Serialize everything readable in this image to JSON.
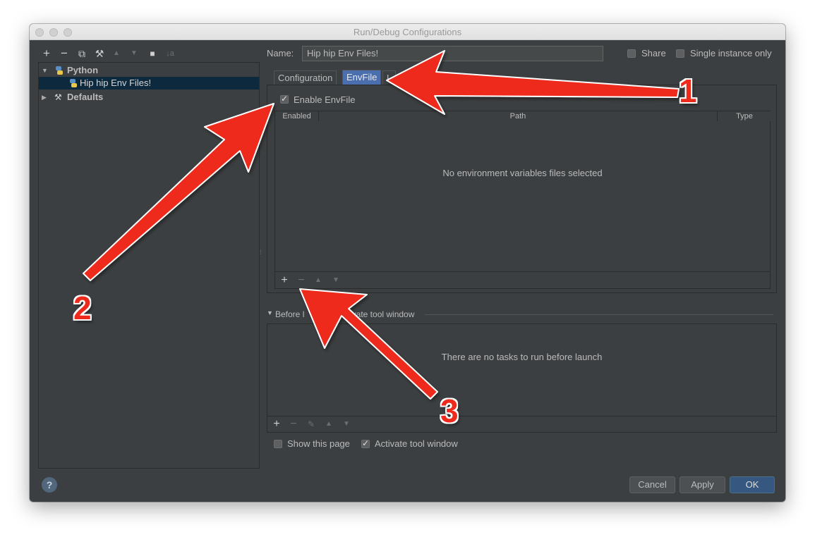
{
  "window": {
    "title": "Run/Debug Configurations"
  },
  "toolbar": {
    "buttons": [
      {
        "name": "add",
        "glyph": "+"
      },
      {
        "name": "remove",
        "glyph": "−"
      },
      {
        "name": "copy",
        "glyph": "⧉"
      },
      {
        "name": "edit-defaults",
        "glyph": "⚒"
      },
      {
        "name": "move-up",
        "glyph": "▲"
      },
      {
        "name": "move-down",
        "glyph": "▼"
      },
      {
        "name": "folder",
        "glyph": "■"
      },
      {
        "name": "sort",
        "glyph": "↓a"
      }
    ]
  },
  "tree": {
    "python": "Python",
    "config": "Hip hip Env Files!",
    "defaults": "Defaults"
  },
  "form": {
    "name_label": "Name:",
    "name_value": "Hip hip Env Files!",
    "share_label": "Share",
    "single_instance_label": "Single instance only",
    "share_checked": false,
    "single_instance_checked": false
  },
  "tabs": [
    {
      "label": "Configuration",
      "active": false
    },
    {
      "label": "EnvFile",
      "active": true
    },
    {
      "label": "L",
      "active": false
    }
  ],
  "envfile": {
    "enable_label": "Enable EnvFile",
    "enable_checked": true,
    "columns": [
      "Enabled",
      "Path",
      "Type"
    ],
    "empty_text": "No environment variables files selected"
  },
  "before_launch": {
    "header": "Before launch: Activate tool window",
    "header_visible_left": "Before l",
    "header_visible_right": "ivate tool window",
    "empty_text": "There are no tasks to run before launch",
    "show_page_label": "Show this page",
    "activate_label": "Activate tool window",
    "show_page_checked": false,
    "activate_checked": true
  },
  "buttons": {
    "cancel": "Cancel",
    "apply": "Apply",
    "ok": "OK",
    "help": "?"
  },
  "annotations": [
    "1",
    "2",
    "3"
  ],
  "colors": {
    "accent": "#4b6eaf",
    "arrow": "#ee2a1c",
    "background": "#3c3f41"
  }
}
